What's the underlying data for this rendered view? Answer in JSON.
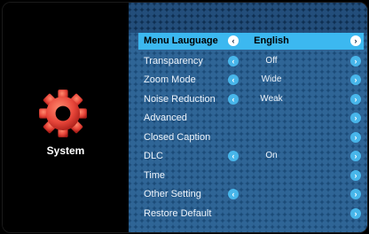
{
  "category": {
    "label": "System",
    "icon": "gear-icon",
    "icon_color": "#e8463a"
  },
  "menu": {
    "items": [
      {
        "label": "Menu Lauguage",
        "value": "English",
        "left_arrow": true,
        "right_arrow": true,
        "selected": true
      },
      {
        "label": "Transparency",
        "value": "Off",
        "left_arrow": true,
        "right_arrow": true
      },
      {
        "label": "Zoom Mode",
        "value": "Wide",
        "left_arrow": true,
        "right_arrow": true
      },
      {
        "label": "Noise Reduction",
        "value": "Weak",
        "left_arrow": true,
        "right_arrow": true
      },
      {
        "label": "Advanced",
        "value": "",
        "left_arrow": false,
        "right_arrow": true
      },
      {
        "label": "Closed Caption",
        "value": "",
        "left_arrow": false,
        "right_arrow": true
      },
      {
        "label": "DLC",
        "value": "On",
        "left_arrow": true,
        "right_arrow": true
      },
      {
        "label": "Time",
        "value": "",
        "left_arrow": false,
        "right_arrow": true
      },
      {
        "label": "Other Setting",
        "value": "",
        "left_arrow": true,
        "right_arrow": true
      },
      {
        "label": "Restore Default",
        "value": "",
        "left_arrow": false,
        "right_arrow": true
      }
    ],
    "left_arrow_glyph": "‹",
    "right_arrow_glyph": "›"
  },
  "colors": {
    "highlight": "#3cb8f0",
    "panel": "#1b4b78",
    "arrow": "#48b6ea"
  }
}
